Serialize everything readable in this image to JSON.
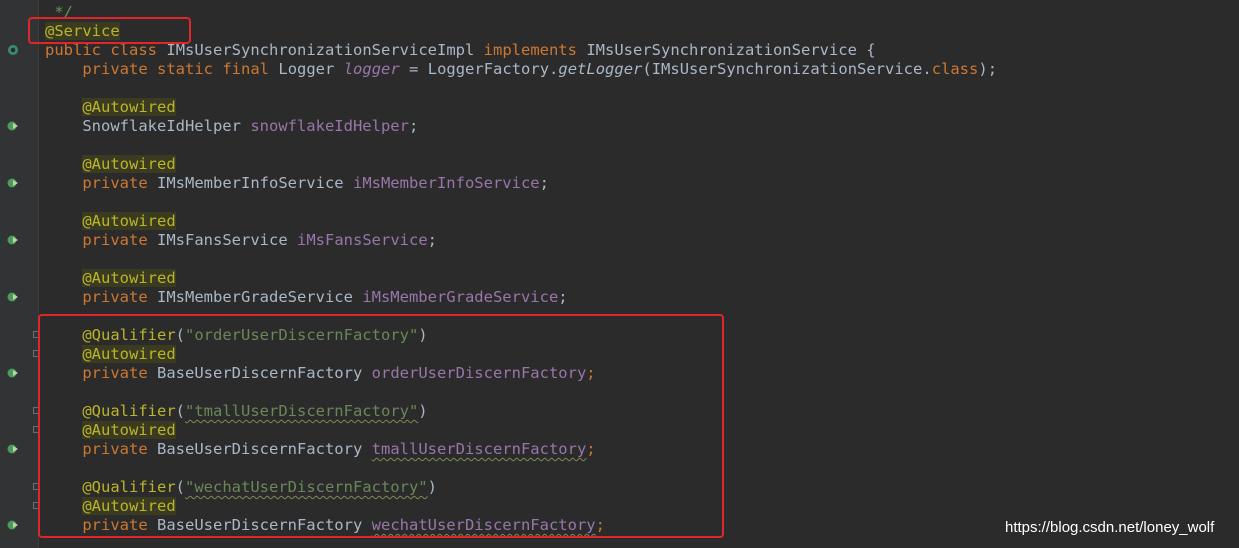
{
  "code": {
    "comment_end": "*/",
    "service_annotation": "@Service",
    "class_line": {
      "kw1": "public",
      "kw2": "class",
      "class_name": "IMsUserSynchronizationServiceImpl",
      "kw3": "implements",
      "interface_name": "IMsUserSynchronizationService",
      "brace": "{"
    },
    "logger_line": {
      "kw1": "private",
      "kw2": "static",
      "kw3": "final",
      "type": "Logger",
      "field": "logger",
      "eq": "=",
      "factory": "LoggerFactory.",
      "method": "getLogger",
      "arg_open": "(IMsUserSynchronizationService.",
      "class_kw": "class",
      "arg_close": ");"
    },
    "autowired": "@Autowired",
    "qualifier": "@Qualifier",
    "private_kw": "private",
    "fields": [
      {
        "type": "SnowflakeIdHelper",
        "name": "snowflakeIdHelper",
        "has_private": false
      },
      {
        "type": "IMsMemberInfoService",
        "name": "iMsMemberInfoService",
        "has_private": true
      },
      {
        "type": "IMsFansService",
        "name": "iMsFansService",
        "has_private": true
      },
      {
        "type": "IMsMemberGradeService",
        "name": "iMsMemberGradeService",
        "has_private": true
      }
    ],
    "qualified_fields": [
      {
        "qualifier_value": "\"orderUserDiscernFactory\"",
        "type": "BaseUserDiscernFactory",
        "name": "orderUserDiscernFactory"
      },
      {
        "qualifier_value": "\"tmallUserDiscernFactory\"",
        "type": "BaseUserDiscernFactory",
        "name": "tmallUserDiscernFactory"
      },
      {
        "qualifier_value": "\"wechatUserDiscernFactory\"",
        "type": "BaseUserDiscernFactory",
        "name": "wechatUserDiscernFactory"
      }
    ]
  },
  "gutter_icons": {
    "class_marker": "implementation-marker-icon",
    "injection_marker": "bean-injection-icon",
    "fold_marker": "fold-toggle-icon"
  },
  "colors": {
    "background": "#2b2b2b",
    "keyword": "#cc7832",
    "annotation": "#bbb529",
    "field": "#9876aa",
    "string": "#6a8759",
    "highlight_box": "#e0262b"
  },
  "watermark": "https://blog.csdn.net/loney_wolf"
}
